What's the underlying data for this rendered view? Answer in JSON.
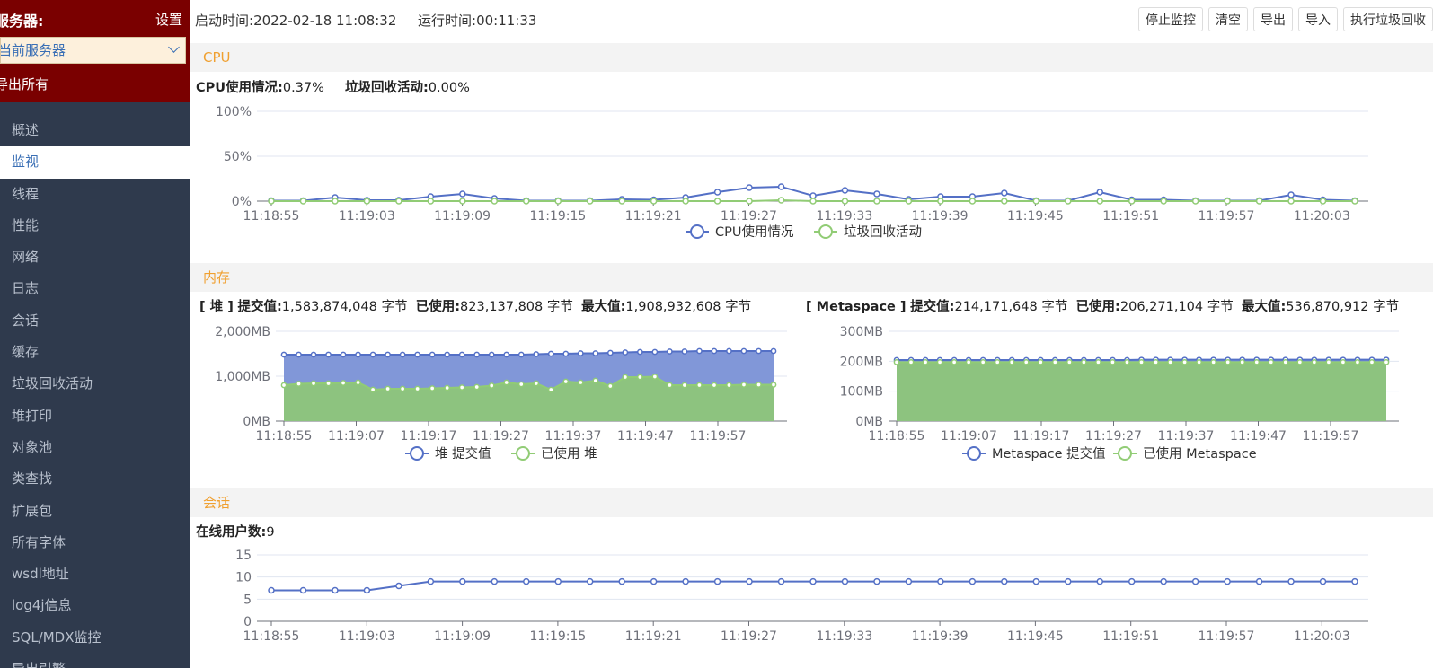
{
  "sidebar": {
    "server_label": "服务器:",
    "settings": "设置",
    "server_select": "当前服务器",
    "export_all": "导出所有",
    "items": [
      {
        "label": "概述"
      },
      {
        "label": "监视"
      },
      {
        "label": "线程"
      },
      {
        "label": "性能"
      },
      {
        "label": "网络"
      },
      {
        "label": "日志"
      },
      {
        "label": "会话"
      },
      {
        "label": "缓存"
      },
      {
        "label": "垃圾回收活动"
      },
      {
        "label": "堆打印"
      },
      {
        "label": "对象池"
      },
      {
        "label": "类查找"
      },
      {
        "label": "扩展包"
      },
      {
        "label": "所有字体"
      },
      {
        "label": "wsdl地址"
      },
      {
        "label": "log4j信息"
      },
      {
        "label": "SQL/MDX监控"
      },
      {
        "label": "导出引擎"
      }
    ],
    "active_index": 1
  },
  "header": {
    "start_time_label": "启动时间:",
    "start_time": "2022-02-18 11:08:32",
    "run_time_label": "运行时间:",
    "run_time": "00:11:33",
    "buttons": {
      "stop": "停止监控",
      "clear": "清空",
      "export": "导出",
      "import": "导入",
      "gc": "执行垃圾回收"
    }
  },
  "cpu": {
    "title": "CPU",
    "usage_label": "CPU使用情况:",
    "usage_value": "0.37%",
    "gc_label": "垃圾回收活动:",
    "gc_value": "0.00%"
  },
  "memory": {
    "title": "内存",
    "heap": {
      "name": "[ 堆 ]",
      "committed_label": "提交值:",
      "committed": "1,583,874,048 字节",
      "used_label": "已使用:",
      "used": "823,137,808 字节",
      "max_label": "最大值:",
      "max": "1,908,932,608 字节"
    },
    "meta": {
      "name": "[ Metaspace ]",
      "committed_label": "提交值:",
      "committed": "214,171,648 字节",
      "used_label": "已使用:",
      "used": "206,271,104 字节",
      "max_label": "最大值:",
      "max": "536,870,912 字节"
    }
  },
  "session": {
    "title": "会话",
    "online_label": "在线用户数:",
    "online_value": "9"
  },
  "colors": {
    "blue": "#5470c6",
    "green": "#91cc75",
    "orange": "#f0a030",
    "sidebar": "#2f3a4d",
    "header_red": "#7a0000"
  },
  "chart_data": [
    {
      "id": "cpu",
      "type": "line",
      "x_ticks": [
        "11:18:55",
        "11:19:03",
        "11:19:09",
        "11:19:15",
        "11:19:21",
        "11:19:27",
        "11:19:33",
        "11:19:39",
        "11:19:45",
        "11:19:51",
        "11:19:57",
        "11:20:03"
      ],
      "ylim": [
        0,
        100
      ],
      "y_ticks": [
        "0%",
        "50%",
        "100%"
      ],
      "y_tick_values": [
        0,
        50,
        100
      ],
      "series": [
        {
          "name": "CPU使用情况",
          "color": "#5470c6",
          "values": [
            0.5,
            0.5,
            4,
            1,
            1,
            5,
            8,
            3,
            0.5,
            0.5,
            0.5,
            2,
            1.5,
            4,
            10,
            15,
            16,
            6,
            12,
            8,
            2,
            5,
            5,
            9,
            0.5,
            0.5,
            10,
            1.5,
            1.5,
            0.5,
            0.5,
            0.5,
            7,
            1.5,
            0.5
          ]
        },
        {
          "name": "垃圾回收活动",
          "color": "#91cc75",
          "values": [
            0,
            0,
            0,
            0,
            0,
            0,
            0,
            0,
            0,
            0,
            0,
            0,
            0,
            0,
            0,
            0,
            1,
            0,
            0,
            0,
            0,
            0,
            0,
            0,
            0,
            0,
            0,
            0,
            0,
            0,
            0,
            0,
            0,
            0,
            0
          ]
        }
      ]
    },
    {
      "id": "heap",
      "type": "area",
      "x_ticks": [
        "11:18:55",
        "11:19:07",
        "11:19:17",
        "11:19:27",
        "11:19:37",
        "11:19:47",
        "11:19:57"
      ],
      "ylim": [
        0,
        2000
      ],
      "y_ticks": [
        "0MB",
        "1,000MB",
        "2,000MB"
      ],
      "y_tick_values": [
        0,
        1000,
        2000
      ],
      "series": [
        {
          "name": "堆 提交值",
          "color": "#5470c6",
          "values": [
            1480,
            1480,
            1480,
            1480,
            1480,
            1480,
            1480,
            1480,
            1480,
            1480,
            1480,
            1480,
            1480,
            1480,
            1480,
            1480,
            1480,
            1490,
            1500,
            1500,
            1510,
            1510,
            1520,
            1530,
            1540,
            1540,
            1550,
            1550,
            1560,
            1560,
            1560,
            1560,
            1560,
            1560
          ]
        },
        {
          "name": "已使用 堆",
          "color": "#91cc75",
          "values": [
            800,
            830,
            840,
            840,
            850,
            860,
            700,
            720,
            720,
            720,
            730,
            740,
            750,
            760,
            790,
            860,
            820,
            840,
            700,
            880,
            860,
            900,
            780,
            980,
            980,
            990,
            800,
            800,
            800,
            800,
            800,
            810,
            810,
            810
          ]
        }
      ]
    },
    {
      "id": "meta",
      "type": "area",
      "x_ticks": [
        "11:18:55",
        "11:19:07",
        "11:19:17",
        "11:19:27",
        "11:19:37",
        "11:19:47",
        "11:19:57"
      ],
      "ylim": [
        0,
        300
      ],
      "y_ticks": [
        "0MB",
        "100MB",
        "200MB",
        "300MB"
      ],
      "y_tick_values": [
        0,
        100,
        200,
        300
      ],
      "series": [
        {
          "name": "Metaspace 提交值",
          "color": "#5470c6",
          "values": [
            204,
            204,
            204,
            204,
            204,
            204,
            204,
            204,
            204,
            204,
            204,
            204,
            204,
            204,
            204,
            204,
            204,
            205,
            205,
            205,
            205,
            205,
            205,
            205,
            205,
            205,
            205,
            205,
            205,
            205,
            205,
            205,
            205,
            205,
            205
          ]
        },
        {
          "name": "已使用 Metaspace",
          "color": "#91cc75",
          "values": [
            197,
            197,
            197,
            197,
            197,
            197,
            197,
            197,
            197,
            197,
            197,
            197,
            197,
            197,
            197,
            197,
            197,
            197,
            197,
            197,
            197,
            197,
            197,
            197,
            197,
            197,
            197,
            197,
            197,
            197,
            197,
            197,
            197,
            197,
            197
          ]
        }
      ]
    },
    {
      "id": "session",
      "type": "line",
      "x_ticks": [
        "11:18:55",
        "11:19:03",
        "11:19:09",
        "11:19:15",
        "11:19:21",
        "11:19:27",
        "11:19:33",
        "11:19:39",
        "11:19:45",
        "11:19:51",
        "11:19:57",
        "11:20:03"
      ],
      "ylim": [
        0,
        15
      ],
      "y_ticks": [
        "0",
        "5",
        "10",
        "15"
      ],
      "y_tick_values": [
        0,
        5,
        10,
        15
      ],
      "series": [
        {
          "name": "在线用户数",
          "color": "#5470c6",
          "values": [
            7,
            7,
            7,
            7,
            8,
            9,
            9,
            9,
            9,
            9,
            9,
            9,
            9,
            9,
            9,
            9,
            9,
            9,
            9,
            9,
            9,
            9,
            9,
            9,
            9,
            9,
            9,
            9,
            9,
            9,
            9,
            9,
            9,
            9,
            9
          ]
        }
      ]
    }
  ]
}
